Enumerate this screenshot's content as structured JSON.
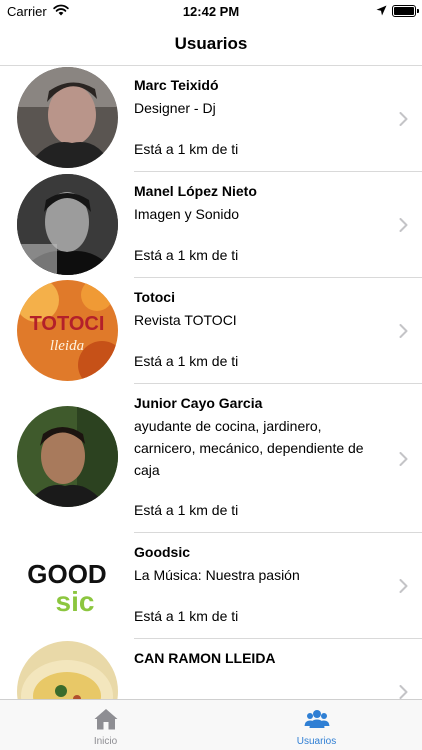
{
  "status": {
    "carrier": "Carrier",
    "time": "12:42 PM"
  },
  "nav": {
    "title": "Usuarios"
  },
  "users": [
    {
      "name": "Marc Teixidó",
      "description": "Designer - Dj",
      "distance": "Está a 1 km de ti"
    },
    {
      "name": "Manel López Nieto",
      "description": "Imagen y Sonido",
      "distance": "Está a 1 km de ti"
    },
    {
      "name": "Totoci",
      "description": "Revista TOTOCI",
      "distance": "Está a 1 km de ti",
      "avatar_text": "TOTOCI",
      "avatar_subtext": "lleida"
    },
    {
      "name": "Junior Cayo Garcia",
      "description": "ayudante de cocina, jardinero, carnicero, mecánico, dependiente de caja",
      "distance": "Está a 1 km de ti"
    },
    {
      "name": "Goodsic",
      "description": "La Música: Nuestra pasión",
      "distance": "Está a 1 km de ti",
      "avatar_text": "GOOD",
      "avatar_subtext": "sic"
    },
    {
      "name": "CAN RAMON LLEIDA",
      "description": "",
      "distance": ""
    }
  ],
  "tabs": [
    {
      "label": "Inicio",
      "icon": "home-icon",
      "active": false
    },
    {
      "label": "Usuarios",
      "icon": "users-icon",
      "active": true
    }
  ],
  "colors": {
    "accent": "#2f7fd4",
    "inactive_tab": "#8e8e93",
    "separator": "#d9d9d9",
    "chevron": "#c4c4c7"
  }
}
